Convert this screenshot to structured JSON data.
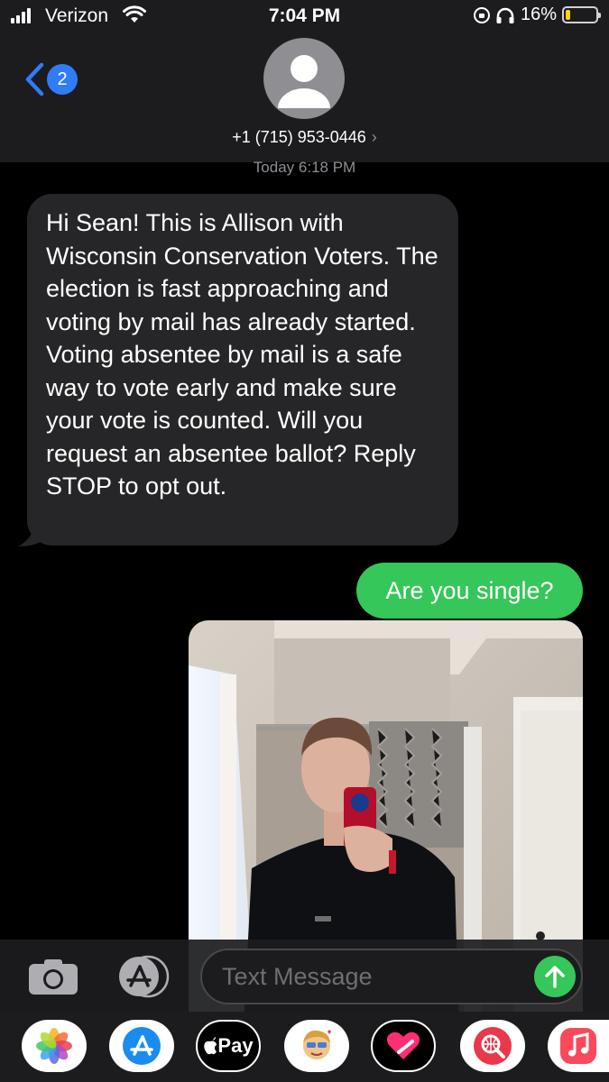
{
  "status_bar": {
    "carrier": "Verizon",
    "time": "7:04 PM",
    "battery": "16%",
    "battery_level": 0.16
  },
  "header": {
    "back_badge": "2",
    "contact_number": "+1 (715) 953-0446",
    "contact_chevron": "›"
  },
  "conversation": {
    "timestamp_day": "Today",
    "timestamp_time": "6:18 PM",
    "incoming_message": "Hi Sean! This is Allison with Wisconsin Conservation Voters. The election is fast approaching and voting by mail has already started. Voting absentee by mail is a safe way to vote early and make sure your vote is counted. Will you request an absentee ballot? Reply STOP to opt out.",
    "outgoing_message": "Are you single?"
  },
  "input_bar": {
    "placeholder": "Text Message"
  },
  "app_drawer": {
    "apple_pay_label": "Pay",
    "apps": [
      "photos-icon",
      "app-store-icon",
      "apple-pay-icon",
      "memoji-icon",
      "digital-touch-icon",
      "web-search-icon",
      "music-icon"
    ]
  },
  "colors": {
    "background": "#000000",
    "header": "#1c1c1e",
    "incoming_bubble": "#262628",
    "outgoing_bubble": "#35c759",
    "accent": "#2f7cf6",
    "battery": "#ffd60a"
  }
}
